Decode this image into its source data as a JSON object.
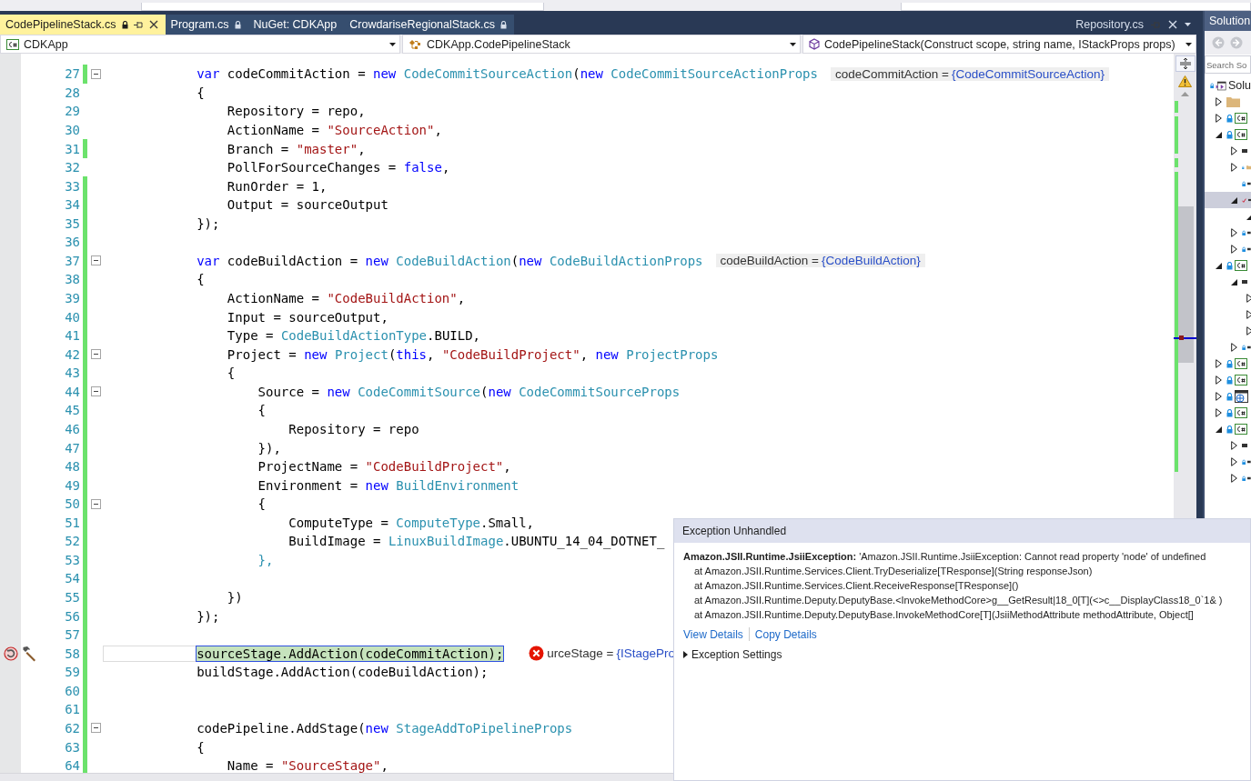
{
  "tabs": [
    {
      "label": "CodePipelineStack.cs",
      "selected": true,
      "locked": true
    },
    {
      "label": "Program.cs",
      "selected": false,
      "locked": true
    },
    {
      "label": "NuGet: CDKApp",
      "selected": false,
      "locked": false
    },
    {
      "label": "CrowdariseRegionalStack.cs",
      "selected": false,
      "locked": true
    }
  ],
  "preview_tab": {
    "label": "Repository.cs"
  },
  "navigation": [
    {
      "kind": "project",
      "label": "CDKApp"
    },
    {
      "kind": "class",
      "label": "CDKApp.CodePipelineStack"
    },
    {
      "kind": "member",
      "label": "CodePipelineStack(Construct scope, string name, IStackProps props)"
    }
  ],
  "lines": [
    {
      "number": "27",
      "changed": true,
      "fold": true,
      "current": false,
      "tokens": [
        {
          "kind": "keyword",
          "text": "            var"
        },
        {
          "kind": "plain",
          "text": " codeCommitAction = "
        },
        {
          "kind": "keyword",
          "text": "new"
        },
        {
          "kind": "type",
          "text": " CodeCommitSourceAction"
        },
        {
          "kind": "plain",
          "text": "("
        },
        {
          "kind": "keyword",
          "text": "new"
        },
        {
          "kind": "type",
          "text": " CodeCommitSourceActionProps"
        }
      ],
      "hint": {
        "kind": "value",
        "name": "codeCommitAction = ",
        "value": "{CodeCommitSourceAction}"
      }
    },
    {
      "number": "28",
      "changed": false,
      "fold": false,
      "current": false,
      "tokens": [
        {
          "kind": "plain",
          "text": "            {"
        }
      ]
    },
    {
      "number": "29",
      "changed": false,
      "fold": false,
      "current": false,
      "tokens": [
        {
          "kind": "plain",
          "text": "                Repository = repo,"
        }
      ]
    },
    {
      "number": "30",
      "changed": false,
      "fold": false,
      "current": false,
      "tokens": [
        {
          "kind": "plain",
          "text": "                ActionName = "
        },
        {
          "kind": "string",
          "text": "\"SourceAction\""
        },
        {
          "kind": "plain",
          "text": ","
        }
      ]
    },
    {
      "number": "31",
      "changed": true,
      "fold": false,
      "current": false,
      "tokens": [
        {
          "kind": "plain",
          "text": "                Branch = "
        },
        {
          "kind": "string",
          "text": "\"master\""
        },
        {
          "kind": "plain",
          "text": ","
        }
      ]
    },
    {
      "number": "32",
      "changed": false,
      "fold": false,
      "current": false,
      "tokens": [
        {
          "kind": "plain",
          "text": "                PollForSourceChanges = "
        },
        {
          "kind": "keyword",
          "text": "false"
        },
        {
          "kind": "plain",
          "text": ","
        }
      ]
    },
    {
      "number": "33",
      "changed": true,
      "fold": false,
      "current": false,
      "tokens": [
        {
          "kind": "plain",
          "text": "                RunOrder = 1,"
        }
      ]
    },
    {
      "number": "34",
      "changed": true,
      "fold": false,
      "current": false,
      "tokens": [
        {
          "kind": "plain",
          "text": "                Output = sourceOutput"
        }
      ]
    },
    {
      "number": "35",
      "changed": true,
      "fold": false,
      "current": false,
      "tokens": [
        {
          "kind": "plain",
          "text": "            });"
        }
      ]
    },
    {
      "number": "36",
      "changed": true,
      "fold": false,
      "current": false
    },
    {
      "number": "37",
      "changed": true,
      "fold": true,
      "current": false,
      "tokens": [
        {
          "kind": "keyword",
          "text": "            var"
        },
        {
          "kind": "plain",
          "text": " codeBuildAction = "
        },
        {
          "kind": "keyword",
          "text": "new"
        },
        {
          "kind": "type",
          "text": " CodeBuildAction"
        },
        {
          "kind": "plain",
          "text": "("
        },
        {
          "kind": "keyword",
          "text": "new"
        },
        {
          "kind": "type",
          "text": " CodeBuildActionProps"
        }
      ],
      "hint": {
        "kind": "value",
        "name": "codeBuildAction = ",
        "value": "{CodeBuildAction}"
      }
    },
    {
      "number": "38",
      "changed": true,
      "fold": false,
      "current": false,
      "tokens": [
        {
          "kind": "plain",
          "text": "            {"
        }
      ]
    },
    {
      "number": "39",
      "changed": true,
      "fold": false,
      "current": false,
      "tokens": [
        {
          "kind": "plain",
          "text": "                ActionName = "
        },
        {
          "kind": "string",
          "text": "\"CodeBuildAction\""
        },
        {
          "kind": "plain",
          "text": ","
        }
      ]
    },
    {
      "number": "40",
      "changed": true,
      "fold": false,
      "current": false,
      "tokens": [
        {
          "kind": "plain",
          "text": "                Input = sourceOutput,"
        }
      ]
    },
    {
      "number": "41",
      "changed": true,
      "fold": false,
      "current": false,
      "tokens": [
        {
          "kind": "plain",
          "text": "                Type = "
        },
        {
          "kind": "type",
          "text": "CodeBuildActionType"
        },
        {
          "kind": "plain",
          "text": ".BUILD,"
        }
      ]
    },
    {
      "number": "42",
      "changed": true,
      "fold": true,
      "current": false,
      "tokens": [
        {
          "kind": "plain",
          "text": "                Project = "
        },
        {
          "kind": "keyword",
          "text": "new"
        },
        {
          "kind": "type",
          "text": " Project"
        },
        {
          "kind": "plain",
          "text": "("
        },
        {
          "kind": "keyword",
          "text": "this"
        },
        {
          "kind": "plain",
          "text": ", "
        },
        {
          "kind": "string",
          "text": "\"CodeBuildProject\""
        },
        {
          "kind": "plain",
          "text": ", "
        },
        {
          "kind": "keyword",
          "text": "new"
        },
        {
          "kind": "type",
          "text": " ProjectProps"
        }
      ]
    },
    {
      "number": "43",
      "changed": true,
      "fold": false,
      "current": false,
      "tokens": [
        {
          "kind": "plain",
          "text": "                {"
        }
      ]
    },
    {
      "number": "44",
      "changed": true,
      "fold": true,
      "current": false,
      "tokens": [
        {
          "kind": "plain",
          "text": "                    Source = "
        },
        {
          "kind": "keyword",
          "text": "new"
        },
        {
          "kind": "type",
          "text": " CodeCommitSource"
        },
        {
          "kind": "plain",
          "text": "("
        },
        {
          "kind": "keyword",
          "text": "new"
        },
        {
          "kind": "type",
          "text": " CodeCommitSourceProps"
        }
      ]
    },
    {
      "number": "45",
      "changed": true,
      "fold": false,
      "current": false,
      "tokens": [
        {
          "kind": "plain",
          "text": "                    {"
        }
      ]
    },
    {
      "number": "46",
      "changed": true,
      "fold": false,
      "current": false,
      "tokens": [
        {
          "kind": "plain",
          "text": "                        Repository = repo"
        }
      ]
    },
    {
      "number": "47",
      "changed": true,
      "fold": false,
      "current": false,
      "tokens": [
        {
          "kind": "plain",
          "text": "                    }),"
        }
      ]
    },
    {
      "number": "48",
      "changed": true,
      "fold": false,
      "current": false,
      "tokens": [
        {
          "kind": "plain",
          "text": "                    ProjectName = "
        },
        {
          "kind": "string",
          "text": "\"CodeBuildProject\""
        },
        {
          "kind": "plain",
          "text": ","
        }
      ]
    },
    {
      "number": "49",
      "changed": true,
      "fold": false,
      "current": false,
      "tokens": [
        {
          "kind": "plain",
          "text": "                    Environment = "
        },
        {
          "kind": "keyword",
          "text": "new"
        },
        {
          "kind": "type",
          "text": " BuildEnvironment"
        }
      ]
    },
    {
      "number": "50",
      "changed": true,
      "fold": true,
      "current": false,
      "tokens": [
        {
          "kind": "plain",
          "text": "                    {"
        }
      ]
    },
    {
      "number": "51",
      "changed": true,
      "fold": false,
      "current": false,
      "tokens": [
        {
          "kind": "plain",
          "text": "                        ComputeType = "
        },
        {
          "kind": "type",
          "text": "ComputeType"
        },
        {
          "kind": "plain",
          "text": ".Small,"
        }
      ]
    },
    {
      "number": "52",
      "changed": true,
      "fold": false,
      "current": false,
      "tokens": [
        {
          "kind": "plain",
          "text": "                        BuildImage = "
        },
        {
          "kind": "type",
          "text": "LinuxBuildImage"
        },
        {
          "kind": "plain",
          "text": ".UBUNTU_14_04_DOTNET_"
        }
      ]
    },
    {
      "number": "53",
      "changed": true,
      "fold": false,
      "current": false,
      "tokens": [
        {
          "kind": "type",
          "text": "                    },"
        }
      ]
    },
    {
      "number": "54",
      "changed": true,
      "fold": false,
      "current": false
    },
    {
      "number": "55",
      "changed": true,
      "fold": false,
      "current": false,
      "tokens": [
        {
          "kind": "plain",
          "text": "                })"
        }
      ]
    },
    {
      "number": "56",
      "changed": true,
      "fold": false,
      "current": false,
      "tokens": [
        {
          "kind": "plain",
          "text": "            });"
        }
      ]
    },
    {
      "number": "57",
      "changed": true,
      "fold": false,
      "current": false
    },
    {
      "number": "58",
      "changed": true,
      "fold": false,
      "current": true,
      "tokens": [
        {
          "kind": "plain",
          "text": "            sourceStage.AddAction(codeCommitAction);"
        }
      ],
      "hint": {
        "kind": "error",
        "name": "urceStage = ",
        "value": "{IStagePro"
      }
    },
    {
      "number": "59",
      "changed": true,
      "fold": false,
      "current": false,
      "tokens": [
        {
          "kind": "plain",
          "text": "            buildStage.AddAction(codeBuildAction);"
        }
      ]
    },
    {
      "number": "60",
      "changed": true,
      "fold": false,
      "current": false
    },
    {
      "number": "61",
      "changed": true,
      "fold": false,
      "current": false
    },
    {
      "number": "62",
      "changed": true,
      "fold": true,
      "current": false,
      "tokens": [
        {
          "kind": "plain",
          "text": "            codePipeline.AddStage("
        },
        {
          "kind": "keyword",
          "text": "new"
        },
        {
          "kind": "type",
          "text": " StageAddToPipelineProps"
        }
      ]
    },
    {
      "number": "63",
      "changed": true,
      "fold": false,
      "current": false,
      "tokens": [
        {
          "kind": "plain",
          "text": "            {"
        }
      ]
    },
    {
      "number": "64",
      "changed": true,
      "fold": false,
      "current": false,
      "tokens": [
        {
          "kind": "plain",
          "text": "                Name = "
        },
        {
          "kind": "string",
          "text": "\"SourceStage\""
        },
        {
          "kind": "plain",
          "text": ","
        }
      ]
    }
  ],
  "solution_explorer": {
    "title": "Solution",
    "search": {
      "placeholder": "Search So"
    },
    "tree": [
      {
        "kind": "solution",
        "label": "Solu",
        "locked": true,
        "checked_out": false,
        "selected": false,
        "children": [
          {
            "kind": "folder",
            "expanded": false,
            "locked": false,
            "checked_out": false,
            "selected": false
          },
          {
            "kind": "project",
            "locked": true,
            "checked_out": false,
            "expanded": false,
            "selected": false
          },
          {
            "kind": "project",
            "locked": true,
            "checked_out": false,
            "expanded": true,
            "selected": false,
            "children": [
              {
                "kind": "item",
                "expanded": false,
                "locked": false,
                "checked_out": false,
                "selected": false
              },
              {
                "kind": "folder",
                "locked": true,
                "checked_out": false,
                "expanded": false,
                "selected": false
              },
              {
                "kind": "item",
                "locked": true,
                "checked_out": false,
                "selected": false
              },
              {
                "kind": "item",
                "locked": false,
                "checked_out": true,
                "expanded": true,
                "selected": true,
                "children": [
                  {
                    "expanded": true,
                    "locked": false,
                    "checked_out": false,
                    "selected": false
                  }
                ]
              },
              {
                "kind": "item",
                "locked": true,
                "checked_out": false,
                "expanded": false,
                "selected": false
              },
              {
                "kind": "item",
                "locked": true,
                "checked_out": false,
                "expanded": false,
                "selected": false
              }
            ]
          },
          {
            "kind": "project",
            "locked": true,
            "checked_out": false,
            "expanded": true,
            "selected": false,
            "children": [
              {
                "kind": "item",
                "expanded": true,
                "locked": false,
                "checked_out": false,
                "selected": false,
                "children": [
                  {
                    "expanded": false,
                    "locked": false,
                    "checked_out": false,
                    "selected": false
                  },
                  {
                    "expanded": false,
                    "locked": false,
                    "checked_out": false,
                    "selected": false
                  },
                  {
                    "expanded": false,
                    "locked": false,
                    "checked_out": false,
                    "selected": false
                  }
                ]
              },
              {
                "kind": "item",
                "locked": true,
                "checked_out": false,
                "expanded": false,
                "selected": false
              }
            ]
          },
          {
            "kind": "project",
            "locked": true,
            "checked_out": false,
            "expanded": false,
            "selected": false
          },
          {
            "kind": "project",
            "locked": true,
            "checked_out": false,
            "expanded": false,
            "selected": false
          },
          {
            "kind": "web",
            "locked": true,
            "checked_out": false,
            "expanded": false,
            "selected": false
          },
          {
            "kind": "project",
            "locked": true,
            "checked_out": false,
            "expanded": false,
            "selected": false
          },
          {
            "kind": "project",
            "locked": true,
            "checked_out": false,
            "expanded": true,
            "selected": false,
            "children": [
              {
                "kind": "item",
                "expanded": false,
                "locked": false,
                "checked_out": false,
                "selected": false
              },
              {
                "kind": "item",
                "locked": true,
                "checked_out": false,
                "expanded": false,
                "selected": false
              },
              {
                "kind": "item",
                "locked": true,
                "checked_out": false,
                "expanded": false,
                "selected": false
              }
            ]
          }
        ]
      }
    ]
  },
  "exception": {
    "title": "Exception Unhandled",
    "type": "Amazon.JSII.Runtime.JsiiException:",
    "message": "'Amazon.JSII.Runtime.JsiiException: Cannot read property 'node' of undefined",
    "stack": [
      "at Amazon.JSII.Runtime.Services.Client.TryDeserialize[TResponse](String responseJson)",
      "at Amazon.JSII.Runtime.Services.Client.ReceiveResponse[TResponse]()",
      "at Amazon.JSII.Runtime.Deputy.DeputyBase.<InvokeMethodCore>g__GetResult|18_0[T](<>c__DisplayClass18_0`1& )",
      "at Amazon.JSII.Runtime.Deputy.DeputyBase.InvokeMethodCore[T](JsiiMethodAttribute methodAttribute, Object[]"
    ],
    "links": [
      "View Details",
      "Copy Details"
    ],
    "settings": {
      "label": "Exception Settings",
      "expanded": false
    }
  }
}
